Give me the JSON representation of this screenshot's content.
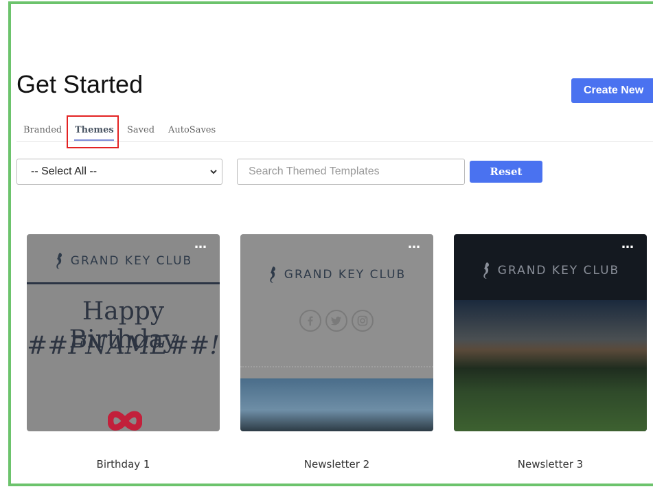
{
  "header": {
    "title": "Get Started",
    "create_label": "Create New"
  },
  "tabs": [
    {
      "label": "Branded",
      "active": false
    },
    {
      "label": "Themes",
      "active": true
    },
    {
      "label": "Saved",
      "active": false
    },
    {
      "label": "AutoSaves",
      "active": false
    }
  ],
  "filters": {
    "select_value": "-- Select All --",
    "search_placeholder": "Search Themed Templates",
    "search_value": "",
    "reset_label": "Reset"
  },
  "cards": [
    {
      "caption": "Birthday 1",
      "more": "…",
      "logo_text": "GRAND KEY CLUB",
      "line1": "Happy Birthday",
      "line2": "##FNAME##!"
    },
    {
      "caption": "Newsletter 2",
      "more": "…",
      "logo_text": "GRAND KEY CLUB"
    },
    {
      "caption": "Newsletter 3",
      "more": "…",
      "logo_text": "GRAND KEY CLUB"
    }
  ],
  "colors": {
    "accent": "#4a72f0",
    "frame": "#6cc36c",
    "highlight": "#e32222"
  }
}
